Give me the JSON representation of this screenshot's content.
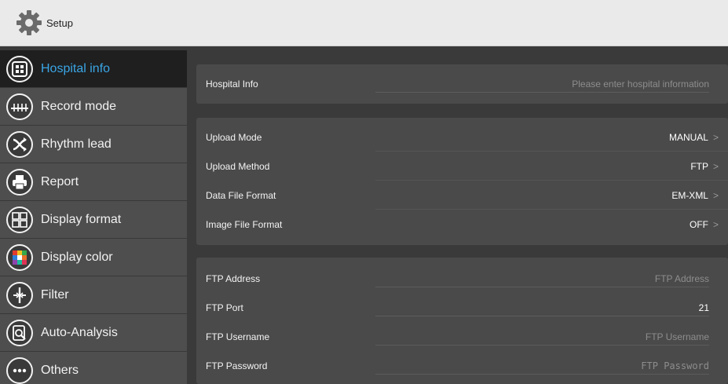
{
  "titlebar": {
    "title": "Setup"
  },
  "sidebar": {
    "items": [
      {
        "label": "Hospital info",
        "icon": "hospital-grid-icon",
        "active": true
      },
      {
        "label": "Record mode",
        "icon": "record-waveform-icon"
      },
      {
        "label": "Rhythm lead",
        "icon": "rhythm-lead-icon"
      },
      {
        "label": "Report",
        "icon": "printer-icon"
      },
      {
        "label": "Display format",
        "icon": "display-grid-icon"
      },
      {
        "label": "Display color",
        "icon": "color-palette-icon"
      },
      {
        "label": "Filter",
        "icon": "filter-icon"
      },
      {
        "label": "Auto-Analysis",
        "icon": "analysis-magnifier-icon"
      },
      {
        "label": "Others",
        "icon": "more-dots-icon"
      }
    ]
  },
  "hospital": {
    "label": "Hospital Info",
    "placeholder": "Please enter hospital information"
  },
  "upload": {
    "mode_label": "Upload Mode",
    "mode_value": "MANUAL",
    "method_label": "Upload Method",
    "method_value": "FTP",
    "data_format_label": "Data File Format",
    "data_format_value": "EM-XML",
    "image_format_label": "Image File Format",
    "image_format_value": "OFF"
  },
  "ftp": {
    "address_label": "FTP Address",
    "address_placeholder": "FTP Address",
    "port_label": "FTP Port",
    "port_value": "21",
    "username_label": "FTP Username",
    "username_placeholder": "FTP Username",
    "password_label": "FTP Password",
    "password_placeholder": "FTP Password"
  },
  "chevron": ">",
  "colors": {
    "accent": "#3aa6e6",
    "panel": "#4a4a4a",
    "background": "#3a3a3a"
  }
}
